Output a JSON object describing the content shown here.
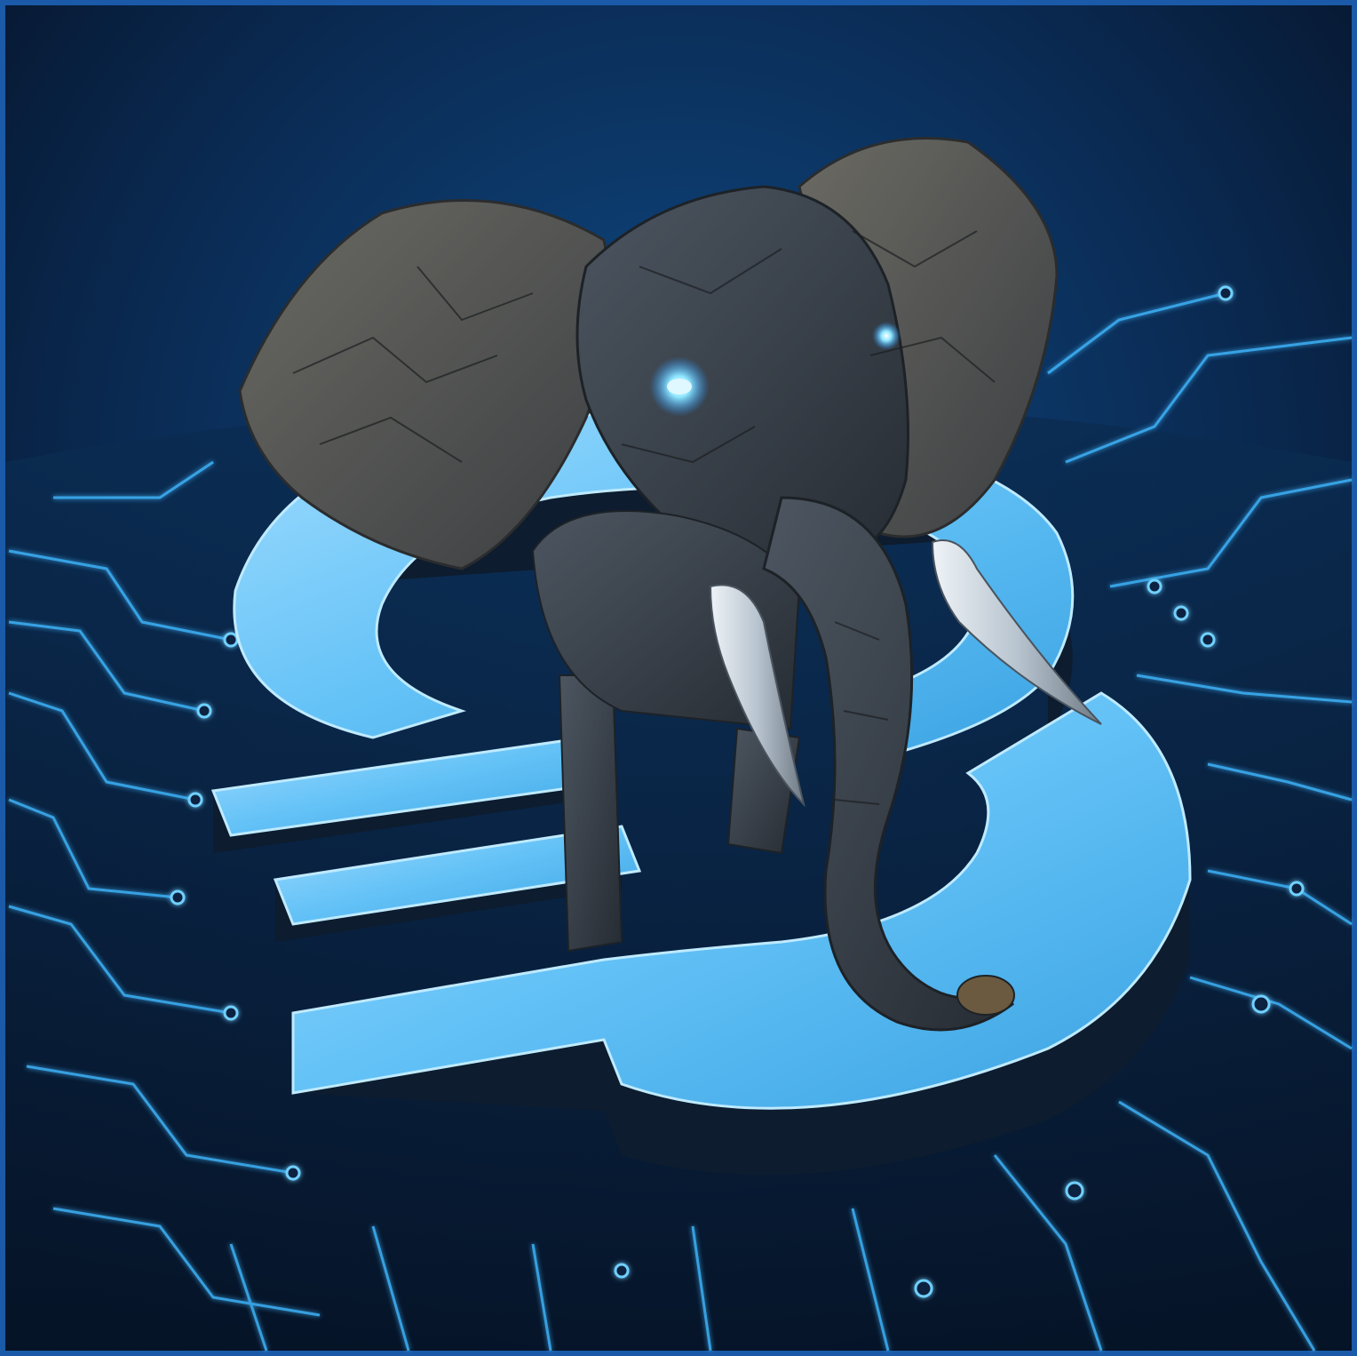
{
  "colors": {
    "frame": "#1a5aa8",
    "background_top": "#071a33",
    "background_mid": "#0d3d72",
    "board": "#0a2440",
    "trace": "#3fb8ff",
    "symbol_face": "#6fcbff",
    "symbol_side": "#0d1c2e",
    "elephant_skin": "#3f4752",
    "elephant_ear": "#5a5c5a",
    "tusk": "#c8d3dc",
    "eye_glow": "#8fe6ff"
  },
  "scene": {
    "subject": "elephant-standing-on-currency-symbol",
    "symbol": "hryvnia-sign-3d",
    "surface": "circuit-board"
  }
}
